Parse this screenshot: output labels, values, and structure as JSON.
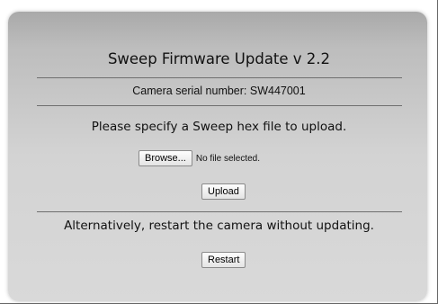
{
  "title": "Sweep Firmware Update v 2.2",
  "serial_text": "Camera serial number: SW447001",
  "instruction": "Please specify a Sweep hex file to upload.",
  "file_input": {
    "browse_label": "Browse...",
    "status": "No file selected."
  },
  "upload_label": "Upload",
  "alternative_text": "Alternatively, restart the camera without updating.",
  "restart_label": "Restart"
}
